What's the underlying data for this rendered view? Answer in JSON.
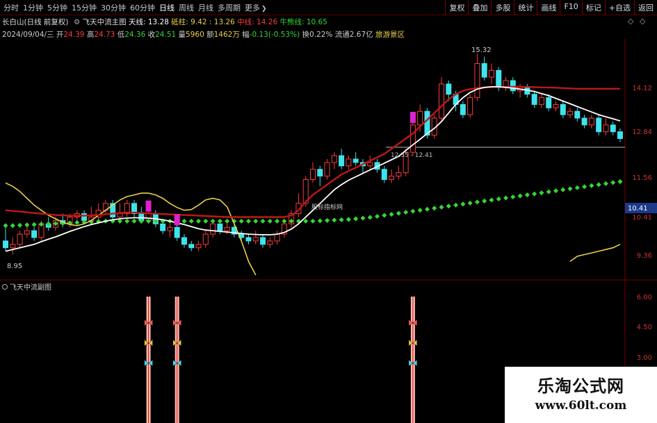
{
  "toolbar": {
    "periods": [
      "分时",
      "1分钟",
      "5分钟",
      "15分钟",
      "30分钟",
      "60分钟",
      "日线",
      "周线",
      "月线",
      "多周期",
      "更多"
    ],
    "more_arrow": "❯",
    "active_period": "日线",
    "right_buttons": [
      "复权",
      "叠加",
      "多股",
      "统计",
      "画线",
      "F10",
      "标记",
      "+自选",
      "返回"
    ]
  },
  "header": {
    "stock": "长白山(日线 前复权)",
    "indicator_name": "飞天中流主图",
    "sky_line_label": "天线: ",
    "sky_line_value": "13.28",
    "bottom_label": "砥柱: ",
    "bottom_value": "9.42 : 13.26",
    "mid_label": "中线: ",
    "mid_value": "14.26",
    "bull_label": "牛熊线: ",
    "bull_value": "10.65",
    "icon_names": [
      "gear-icon",
      "diamond-icon",
      "chevron-icon"
    ]
  },
  "quote": {
    "date": "2024/09/04/三",
    "open_label": "开",
    "open": "24.39",
    "high_label": "高",
    "high": "24.73",
    "low_label": "低",
    "low": "24.36",
    "close_label": "收",
    "close": "24.51",
    "vol_label": "量",
    "vol": "5960",
    "amount_label": "额",
    "amount": "1462万",
    "change_label": "幅",
    "change": "-0.13(-0.53%)",
    "turnover_label": "换",
    "turnover": "0.22%",
    "float_label": "流通",
    "float": "2.67亿",
    "sector": "旅游景区"
  },
  "main_axis": {
    "ticks": [
      "14.12",
      "12.84",
      "11.56",
      "10.41",
      "9.36"
    ],
    "current_price_tag": "10.41"
  },
  "annotations": {
    "high_mark": "15.32",
    "low_mark": "8.95",
    "mid_mark": "12.35 - 12.41",
    "brand_note": "股标指标网"
  },
  "sub_panel": {
    "title": "飞天中流副图",
    "ticks": [
      "6.00",
      "4.50",
      "3.00"
    ]
  },
  "watermark": {
    "line1": "乐淘公式网",
    "line2": "www.60lt.com"
  },
  "colors": {
    "background": "#000000",
    "up": "#ff3b3b",
    "down": "#3fe3ec",
    "mid_line": "#c01818",
    "white_line": "#ffffff",
    "yellow_line": "#e8d04a",
    "green_dots": "#35d535",
    "signal_bar": "#ffb6a8",
    "magenta": "#e020d0"
  },
  "chart_data": {
    "type": "line",
    "title": "",
    "y_range": [
      8.8,
      15.6
    ],
    "bars": [
      [
        9.8,
        9.6,
        10.2,
        9.5
      ],
      [
        9.6,
        9.7,
        9.9,
        9.4
      ],
      [
        9.7,
        10.0,
        10.1,
        9.6
      ],
      [
        10.0,
        10.1,
        10.3,
        9.9
      ],
      [
        10.1,
        9.9,
        10.2,
        9.8
      ],
      [
        9.9,
        10.3,
        10.4,
        9.8
      ],
      [
        10.3,
        10.2,
        10.5,
        10.1
      ],
      [
        10.2,
        10.4,
        10.5,
        10.1
      ],
      [
        10.4,
        10.3,
        10.6,
        10.2
      ],
      [
        10.3,
        10.5,
        10.6,
        10.2
      ],
      [
        10.5,
        10.6,
        10.7,
        10.4
      ],
      [
        10.6,
        10.4,
        10.7,
        10.3
      ],
      [
        10.4,
        10.5,
        10.8,
        10.3
      ],
      [
        10.5,
        10.7,
        10.9,
        10.4
      ],
      [
        10.7,
        10.9,
        11.0,
        10.6
      ],
      [
        10.9,
        10.5,
        11.0,
        10.4
      ],
      [
        10.5,
        10.6,
        10.9,
        10.4
      ],
      [
        10.6,
        10.9,
        11.0,
        10.5
      ],
      [
        10.9,
        10.6,
        11.0,
        10.5
      ],
      [
        10.6,
        10.4,
        10.8,
        10.3
      ],
      [
        10.4,
        10.6,
        10.7,
        10.3
      ],
      [
        10.6,
        10.3,
        10.7,
        10.2
      ],
      [
        10.3,
        10.1,
        10.4,
        10.0
      ],
      [
        10.1,
        10.2,
        10.3,
        9.9
      ],
      [
        10.2,
        9.9,
        10.3,
        9.8
      ],
      [
        9.9,
        9.7,
        10.0,
        9.6
      ],
      [
        9.7,
        9.6,
        9.8,
        9.5
      ],
      [
        9.6,
        9.7,
        9.8,
        9.5
      ],
      [
        9.7,
        10.0,
        10.1,
        9.6
      ],
      [
        10.0,
        10.3,
        10.4,
        9.9
      ],
      [
        10.3,
        10.1,
        10.4,
        10.0
      ],
      [
        10.1,
        10.2,
        10.4,
        10.0
      ],
      [
        10.2,
        10.0,
        10.3,
        9.9
      ],
      [
        10.0,
        9.9,
        10.1,
        9.8
      ],
      [
        9.9,
        9.8,
        10.0,
        9.7
      ],
      [
        9.8,
        9.9,
        10.1,
        9.7
      ],
      [
        9.9,
        9.7,
        10.0,
        9.6
      ],
      [
        9.7,
        9.8,
        9.9,
        9.6
      ],
      [
        9.8,
        10.0,
        10.1,
        9.7
      ],
      [
        10.0,
        10.3,
        10.4,
        9.9
      ],
      [
        10.3,
        10.6,
        10.7,
        10.2
      ],
      [
        10.6,
        10.9,
        11.2,
        10.5
      ],
      [
        10.9,
        11.6,
        11.7,
        10.8
      ],
      [
        11.6,
        11.9,
        12.1,
        11.5
      ],
      [
        11.9,
        11.7,
        12.0,
        11.4
      ],
      [
        11.7,
        12.1,
        12.2,
        11.6
      ],
      [
        12.1,
        12.3,
        12.4,
        11.9
      ],
      [
        12.3,
        12.0,
        12.5,
        11.9
      ],
      [
        12.0,
        12.2,
        12.3,
        11.9
      ],
      [
        12.2,
        12.1,
        12.4,
        12.0
      ],
      [
        12.1,
        12.0,
        12.2,
        11.8
      ],
      [
        12.0,
        12.1,
        12.3,
        11.9
      ],
      [
        12.1,
        11.9,
        12.2,
        11.8
      ],
      [
        11.9,
        11.6,
        12.0,
        11.5
      ],
      [
        11.6,
        11.7,
        11.9,
        11.5
      ],
      [
        11.7,
        11.8,
        12.0,
        11.6
      ],
      [
        11.8,
        12.4,
        12.5,
        11.7
      ],
      [
        12.4,
        13.2,
        13.3,
        12.3
      ],
      [
        13.2,
        13.6,
        13.8,
        13.0
      ],
      [
        13.6,
        12.9,
        13.7,
        12.8
      ],
      [
        12.9,
        13.4,
        13.5,
        12.8
      ],
      [
        13.4,
        14.4,
        14.6,
        13.3
      ],
      [
        14.4,
        14.1,
        14.5,
        13.9
      ],
      [
        14.1,
        13.8,
        14.2,
        13.6
      ],
      [
        13.8,
        13.5,
        13.9,
        13.4
      ],
      [
        13.5,
        14.0,
        14.1,
        13.4
      ],
      [
        14.0,
        15.0,
        15.3,
        13.9
      ],
      [
        15.0,
        14.6,
        15.2,
        14.5
      ],
      [
        14.6,
        14.8,
        15.0,
        14.4
      ],
      [
        14.8,
        14.3,
        14.9,
        14.2
      ],
      [
        14.3,
        14.5,
        14.6,
        14.2
      ],
      [
        14.5,
        14.2,
        14.6,
        14.1
      ],
      [
        14.2,
        14.3,
        14.4,
        14.0
      ],
      [
        14.3,
        14.1,
        14.4,
        14.0
      ],
      [
        14.1,
        13.8,
        14.2,
        13.7
      ],
      [
        13.8,
        14.0,
        14.1,
        13.7
      ],
      [
        14.0,
        13.7,
        14.1,
        13.6
      ],
      [
        13.7,
        13.8,
        13.9,
        13.6
      ],
      [
        13.8,
        13.5,
        13.9,
        13.4
      ],
      [
        13.5,
        13.6,
        13.7,
        13.4
      ],
      [
        13.6,
        13.4,
        13.7,
        13.3
      ],
      [
        13.4,
        13.2,
        13.5,
        13.1
      ],
      [
        13.2,
        13.4,
        13.5,
        13.1
      ],
      [
        13.4,
        13.0,
        13.5,
        12.9
      ],
      [
        13.0,
        13.2,
        13.4,
        12.9
      ],
      [
        13.2,
        13.0,
        13.3,
        12.9
      ],
      [
        13.0,
        12.8,
        13.1,
        12.7
      ]
    ],
    "mid_line": [
      10.7,
      10.68,
      10.66,
      10.64,
      10.62,
      10.6,
      10.58,
      10.56,
      10.55,
      10.54,
      10.54,
      10.54,
      10.55,
      10.56,
      10.58,
      10.6,
      10.62,
      10.63,
      10.63,
      10.62,
      10.61,
      10.6,
      10.59,
      10.58,
      10.57,
      10.56,
      10.55,
      10.54,
      10.53,
      10.52,
      10.51,
      10.5,
      10.5,
      10.5,
      10.5,
      10.5,
      10.5,
      10.5,
      10.5,
      10.5,
      10.55,
      10.7,
      10.95,
      11.15,
      11.3,
      11.45,
      11.6,
      11.75,
      11.85,
      11.95,
      12.05,
      12.15,
      12.25,
      12.35,
      12.5,
      12.65,
      12.8,
      12.95,
      13.15,
      13.35,
      13.55,
      13.75,
      13.95,
      14.1,
      14.2,
      14.25,
      14.28,
      14.3,
      14.31,
      14.32,
      14.32,
      14.32,
      14.32,
      14.32,
      14.31,
      14.3,
      14.3,
      14.29,
      14.28,
      14.27,
      14.26,
      14.26,
      14.26,
      14.26,
      14.26,
      14.26,
      14.26
    ],
    "white_line": [
      9.5,
      9.55,
      9.6,
      9.65,
      9.7,
      9.78,
      9.85,
      9.92,
      10.0,
      10.08,
      10.15,
      10.22,
      10.28,
      10.33,
      10.38,
      10.42,
      10.45,
      10.47,
      10.48,
      10.48,
      10.47,
      10.45,
      10.42,
      10.38,
      10.33,
      10.28,
      10.22,
      10.16,
      10.12,
      10.1,
      10.08,
      10.06,
      10.04,
      10.02,
      10.0,
      9.99,
      9.98,
      9.98,
      10.0,
      10.05,
      10.15,
      10.3,
      10.5,
      10.7,
      10.9,
      11.1,
      11.3,
      11.45,
      11.58,
      11.68,
      11.78,
      11.88,
      11.98,
      12.08,
      12.18,
      12.28,
      12.45,
      12.62,
      12.78,
      12.95,
      13.1,
      13.3,
      13.55,
      13.8,
      14.0,
      14.15,
      14.25,
      14.3,
      14.32,
      14.32,
      14.3,
      14.28,
      14.25,
      14.22,
      14.18,
      14.12,
      14.06,
      13.98,
      13.9,
      13.82,
      13.74,
      13.66,
      13.58,
      13.5,
      13.44,
      13.38,
      13.32
    ],
    "yellow_line": [
      11.5,
      11.4,
      11.25,
      11.05,
      10.85,
      10.7,
      10.55,
      10.45,
      10.35,
      10.28,
      10.25,
      10.3,
      10.4,
      10.55,
      10.7,
      10.85,
      11.0,
      11.1,
      11.15,
      11.2,
      11.2,
      11.15,
      11.05,
      10.9,
      10.78,
      10.7,
      10.72,
      10.85,
      11.0,
      11.05,
      11.0,
      10.8,
      10.3,
      9.8,
      9.2,
      8.8,
      null,
      null,
      null,
      null,
      null,
      null,
      null,
      null,
      null,
      null,
      null,
      null,
      null,
      null,
      null,
      null,
      null,
      null,
      null,
      null,
      null,
      null,
      null,
      null,
      null,
      null,
      null,
      null,
      null,
      null,
      null,
      null,
      null,
      null,
      null,
      null,
      null,
      null,
      null,
      null,
      null,
      null,
      null,
      9.2,
      9.35,
      9.4,
      9.45,
      9.5,
      9.55,
      9.6,
      9.7
    ],
    "green_dots": [
      10.25,
      10.25,
      10.26,
      10.27,
      10.28,
      10.29,
      10.3,
      10.31,
      10.32,
      10.33,
      10.34,
      10.35,
      10.36,
      10.37,
      10.38,
      10.38,
      10.38,
      10.38,
      10.38,
      10.38,
      10.38,
      10.38,
      10.38,
      10.38,
      10.38,
      10.38,
      10.38,
      10.38,
      10.38,
      10.38,
      10.38,
      10.38,
      10.38,
      10.38,
      10.38,
      10.38,
      10.38,
      10.38,
      10.38,
      10.38,
      10.38,
      10.38,
      10.38,
      10.38,
      10.39,
      10.4,
      10.41,
      10.42,
      10.43,
      10.45,
      10.47,
      10.49,
      10.52,
      10.55,
      10.58,
      10.61,
      10.64,
      10.67,
      10.7,
      10.73,
      10.76,
      10.79,
      10.82,
      10.85,
      10.88,
      10.91,
      10.94,
      10.97,
      11.0,
      11.03,
      11.06,
      11.09,
      11.12,
      11.15,
      11.18,
      11.21,
      11.24,
      11.27,
      11.3,
      11.33,
      11.36,
      11.39,
      11.42,
      11.45,
      11.48,
      11.51,
      11.54
    ],
    "signal_bars": [
      20,
      24,
      57
    ]
  }
}
